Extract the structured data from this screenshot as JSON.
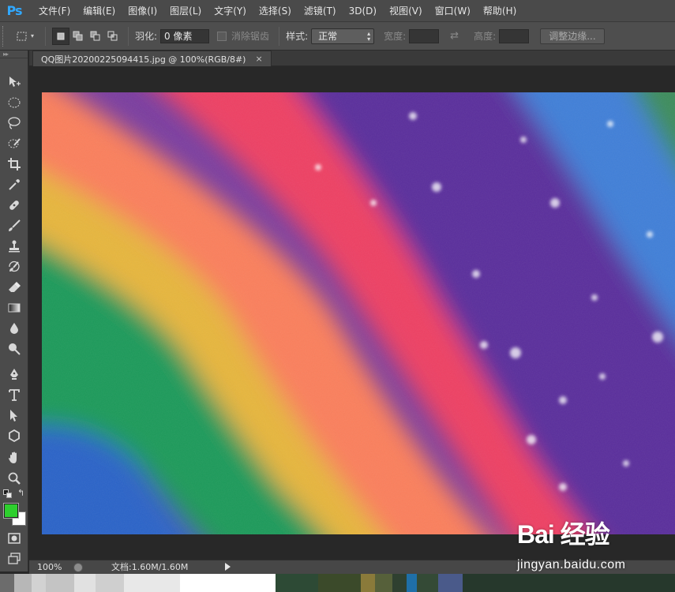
{
  "app": {
    "logo": "Ps"
  },
  "menu": {
    "items": [
      "文件(F)",
      "编辑(E)",
      "图像(I)",
      "图层(L)",
      "文字(Y)",
      "选择(S)",
      "滤镜(T)",
      "3D(D)",
      "视图(V)",
      "窗口(W)",
      "帮助(H)"
    ]
  },
  "options": {
    "feather_label": "羽化:",
    "feather_value": "0 像素",
    "antialias_label": "消除锯齿",
    "style_label": "样式:",
    "style_value": "正常",
    "width_label": "宽度:",
    "height_label": "高度:",
    "refine_edge_button": "调整边缘..."
  },
  "document": {
    "tab_title": "QQ图片20200225094415.jpg @ 100%(RGB/8#)",
    "close_glyph": "×"
  },
  "status": {
    "zoom": "100%",
    "doc_size": "文档:1.60M/1.60M"
  },
  "colors": {
    "foreground": "#2ecf2e",
    "background": "#ffffff",
    "accent": "#31a8ff"
  },
  "tools": [
    "move-tool",
    "marquee-tool",
    "lasso-tool",
    "quick-selection-tool",
    "crop-tool",
    "eyedropper-tool",
    "spot-healing-tool",
    "brush-tool",
    "clone-stamp-tool",
    "history-brush-tool",
    "eraser-tool",
    "gradient-tool",
    "blur-tool",
    "dodge-tool",
    "pen-tool",
    "type-tool",
    "path-selection-tool",
    "shape-tool",
    "hand-tool",
    "zoom-tool"
  ],
  "watermark": {
    "logo": "Bai 经验",
    "sub": "jingyan.baidu.com"
  }
}
